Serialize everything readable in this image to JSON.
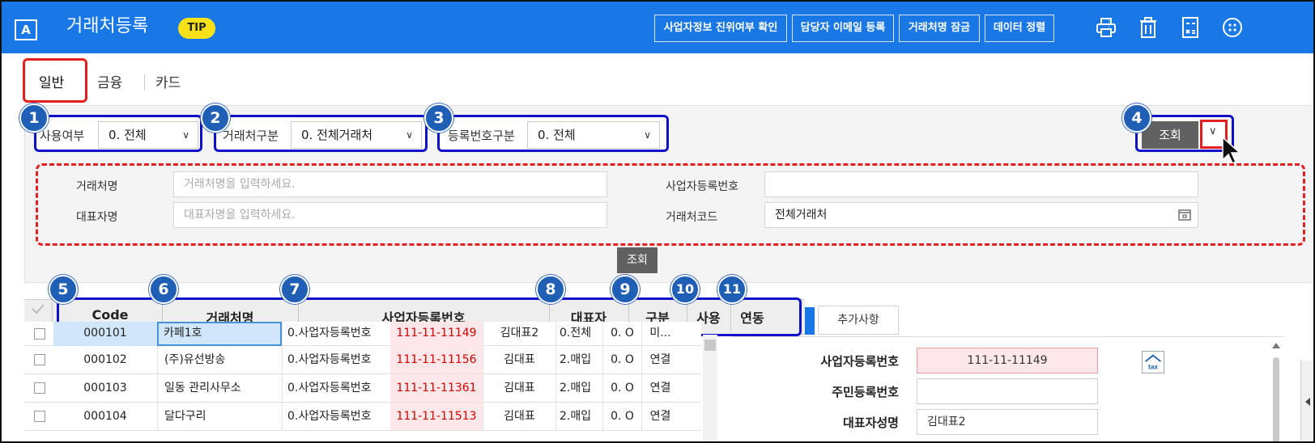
{
  "header": {
    "logo": "A",
    "title": "거래처등록",
    "tip": "TIP",
    "buttons": [
      "사업자정보 진위여부 확인",
      "담당자 이메일 등록",
      "거래처명 잠금",
      "데이터 정렬"
    ],
    "icons": [
      "print-icon",
      "trash-icon",
      "calculator-icon",
      "more-icon"
    ]
  },
  "tabs": [
    "일반",
    "금융",
    "카드"
  ],
  "filters": {
    "use": {
      "label": "사용여부",
      "value": "0. 전체"
    },
    "type": {
      "label": "거래처구분",
      "value": "0. 전체거래처"
    },
    "reg": {
      "label": "등록번호구분",
      "value": "0. 전체"
    },
    "query": "조회"
  },
  "badges": [
    "1",
    "2",
    "3",
    "4",
    "5",
    "6",
    "7",
    "8",
    "9",
    "10",
    "11"
  ],
  "detail": {
    "name_label": "거래처명",
    "name_placeholder": "거래처명을 입력하세요.",
    "rep_label": "대표자명",
    "rep_placeholder": "대표자명을 입력하세요.",
    "bizno_label": "사업자등록번호",
    "bizno_value": "",
    "code_label": "거래처코드",
    "code_value": "전체거래처"
  },
  "center_query": "조회",
  "grid": {
    "headers": [
      "Code",
      "거래처명",
      "사업자등록번호",
      "대표자",
      "구분",
      "사용",
      "연동"
    ],
    "rows": [
      {
        "code": "000101",
        "name": "카페1호",
        "type": "0.사업자등록번호",
        "bizno": "111-11-11149",
        "rep": "김대표2",
        "cat": "0.전체",
        "use": "0. O",
        "link": "미..."
      },
      {
        "code": "000102",
        "name": "(주)유선방송",
        "type": "0.사업자등록번호",
        "bizno": "111-11-11156",
        "rep": "김대표",
        "cat": "2.매입",
        "use": "0. O",
        "link": "연결"
      },
      {
        "code": "000103",
        "name": "일동 관리사무소",
        "type": "0.사업자등록번호",
        "bizno": "111-11-11361",
        "rep": "김대표",
        "cat": "2.매입",
        "use": "0. O",
        "link": "연결"
      },
      {
        "code": "000104",
        "name": "달다구리",
        "type": "0.사업자등록번호",
        "bizno": "111-11-11513",
        "rep": "김대표",
        "cat": "2.매입",
        "use": "0. O",
        "link": "연결"
      }
    ]
  },
  "side_tab": "추가사항",
  "detail_panel": {
    "bizno_label": "사업자등록번호",
    "bizno_value": "111-11-11149",
    "resident_label": "주민등록번호",
    "resident_value": "",
    "rep_label": "대표자성명",
    "rep_value": "김대표2",
    "ntax": "tax"
  },
  "colors": {
    "brand": "#1a78e6",
    "highlight_red": "#e32020",
    "highlight_blue": "#1010c8"
  }
}
